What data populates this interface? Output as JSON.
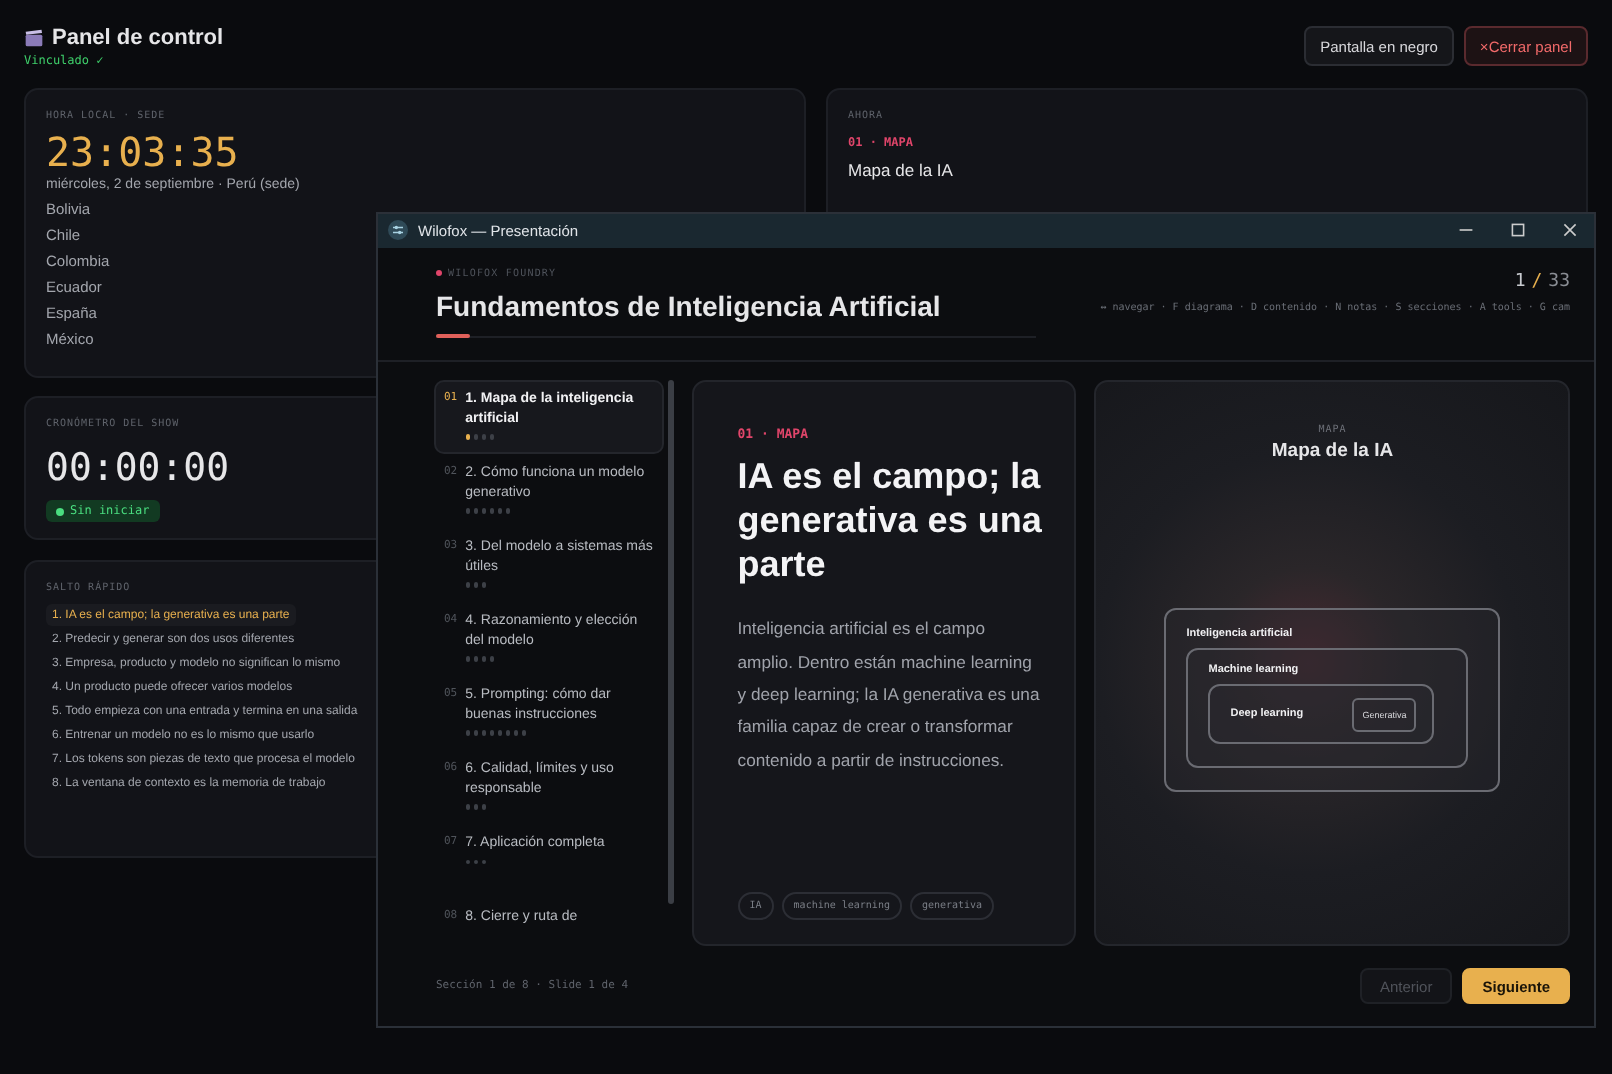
{
  "header": {
    "title": "Panel de control",
    "status": "Vinculado ✓",
    "buttons": [
      {
        "kind": "neutral",
        "label": "Pantalla en negro"
      },
      {
        "kind": "danger",
        "icon": "×",
        "label": "Cerrar panel"
      }
    ]
  },
  "local_time": {
    "label": "HORA LOCAL · SEDE",
    "time": "23:03:35",
    "date": "miércoles, 2 de septiembre · Perú (sede)",
    "countries": [
      "Bolivia",
      "Chile",
      "Colombia",
      "Ecuador",
      "España",
      "México"
    ]
  },
  "stopwatch": {
    "label": "CRONÓMETRO DEL SHOW",
    "time": "00:00:00",
    "status": "Sin iniciar"
  },
  "quick_jump": {
    "label": "SALTO RÁPIDO",
    "items": [
      {
        "label": "1. IA es el campo; la generativa es una parte",
        "selected": true
      },
      {
        "label": "2. Predecir y generar son dos usos diferentes",
        "selected": false
      },
      {
        "label": "3. Empresa, producto y modelo no significan lo mismo",
        "selected": false
      },
      {
        "label": "4. Un producto puede ofrecer varios modelos",
        "selected": false
      },
      {
        "label": "5. Todo empieza con una entrada y termina en una salida",
        "selected": false
      },
      {
        "label": "6. Entrenar un modelo no es lo mismo que usarlo",
        "selected": false
      },
      {
        "label": "7. Los tokens son piezas de texto que procesa el modelo",
        "selected": false
      },
      {
        "label": "8. La ventana de contexto es la memoria de trabajo",
        "selected": false
      }
    ]
  },
  "now": {
    "label": "AHORA",
    "tag": "01 · MAPA",
    "title": "Mapa de la IA"
  },
  "window": {
    "title": "Wilofox — Presentación",
    "brand": "WILOFOX FOUNDRY",
    "deck_title": "Fundamentos de Inteligencia Artificial",
    "page": "1",
    "page_sep": "/",
    "page_total": "33",
    "shortcuts": "↔ navegar · F diagrama · D contenido · N notas · S secciones · A tools · G cam",
    "sections": [
      {
        "number": "01",
        "title": "1. Mapa de la inteligencia artificial",
        "selected": true,
        "slides": [
          {
            "selected": true
          },
          {
            "selected": false
          },
          {
            "selected": false
          },
          {
            "selected": false
          }
        ]
      },
      {
        "number": "02",
        "title": "2. Cómo funciona un modelo generativo",
        "selected": false,
        "slides": [
          {
            "selected": false
          },
          {
            "selected": false
          },
          {
            "selected": false
          },
          {
            "selected": false
          },
          {
            "selected": false
          },
          {
            "selected": false
          }
        ]
      },
      {
        "number": "03",
        "title": "3. Del modelo a sistemas más útiles",
        "selected": false,
        "slides": [
          {
            "selected": false
          },
          {
            "selected": false
          },
          {
            "selected": false
          }
        ]
      },
      {
        "number": "04",
        "title": "4. Razonamiento y elección del modelo",
        "selected": false,
        "slides": [
          {
            "selected": false
          },
          {
            "selected": false
          },
          {
            "selected": false
          },
          {
            "selected": false
          }
        ]
      },
      {
        "number": "05",
        "title": "5. Prompting: cómo dar buenas instrucciones",
        "selected": false,
        "slides": [
          {
            "selected": false
          },
          {
            "selected": false
          },
          {
            "selected": false
          },
          {
            "selected": false
          },
          {
            "selected": false
          },
          {
            "selected": false
          },
          {
            "selected": false
          },
          {
            "selected": false
          }
        ]
      },
      {
        "number": "06",
        "title": "6. Calidad, límites y uso responsable",
        "selected": false,
        "slides": [
          {
            "selected": false
          },
          {
            "selected": false
          },
          {
            "selected": false
          }
        ]
      },
      {
        "number": "07",
        "title": "7. Aplicación completa",
        "selected": false,
        "slides": [
          {
            "selected": false
          },
          {
            "selected": false
          },
          {
            "selected": false
          }
        ]
      },
      {
        "number": "08",
        "title": "8. Cierre y ruta de",
        "selected": false
      }
    ],
    "slide": {
      "tag": "01 · MAPA",
      "heading": "IA es el campo; la generativa es una parte",
      "body": "Inteligencia artificial es el campo amplio. Dentro están machine learning y deep learning; la IA generativa es una familia capaz de crear o transformar contenido a partir de instrucciones.",
      "tags": [
        "IA",
        "machine learning",
        "generativa"
      ]
    },
    "diagram": {
      "label": "MAPA",
      "title": "Mapa de la IA",
      "layers": [
        "Inteligencia artificial",
        "Machine learning",
        "Deep learning",
        "Generativa"
      ]
    },
    "footer": "Sección 1 de 8 · Slide 1 de 4",
    "buttons": [
      {
        "label": "Anterior",
        "disabled": true
      },
      {
        "label": "Siguiente",
        "disabled": false
      }
    ]
  }
}
